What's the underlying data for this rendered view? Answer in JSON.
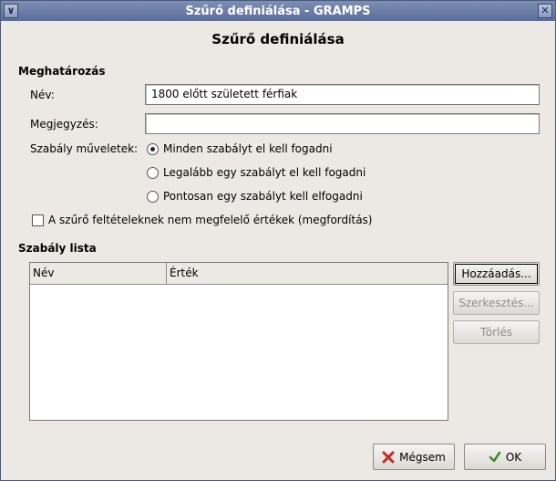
{
  "window": {
    "title": "Szűrő definiálása - GRAMPS",
    "menu_button": "∨",
    "close_button": "✕"
  },
  "heading": "Szűrő definiálása",
  "definition": {
    "section_title": "Meghatározás",
    "name_label": "Név:",
    "name_value": "1800 előtt született férfiak",
    "comment_label": "Megjegyzés:",
    "comment_value": "",
    "rule_ops_label": "Szabály műveletek:",
    "rule_ops": [
      {
        "label": "Minden szabályt el kell fogadni",
        "selected": true
      },
      {
        "label": "Legalább egy szabályt el kell fogadni",
        "selected": false
      },
      {
        "label": "Pontosan egy szabályt kell elfogadni",
        "selected": false
      }
    ],
    "invert_label": "A szűrő feltételeknek nem megfelelő értékek (megfordítás)",
    "invert_checked": false
  },
  "rule_list": {
    "section_title": "Szabály lista",
    "columns": [
      "Név",
      "Érték"
    ],
    "rows": []
  },
  "side_buttons": {
    "add": "Hozzáadás...",
    "edit": "Szerkesztés...",
    "delete": "Törlés"
  },
  "footer": {
    "cancel": "Mégsem",
    "ok": "OK"
  },
  "colors": {
    "titlebar": "#6a7ca5",
    "cancel_icon": "#c62a1f",
    "ok_icon": "#3e8a2a"
  }
}
